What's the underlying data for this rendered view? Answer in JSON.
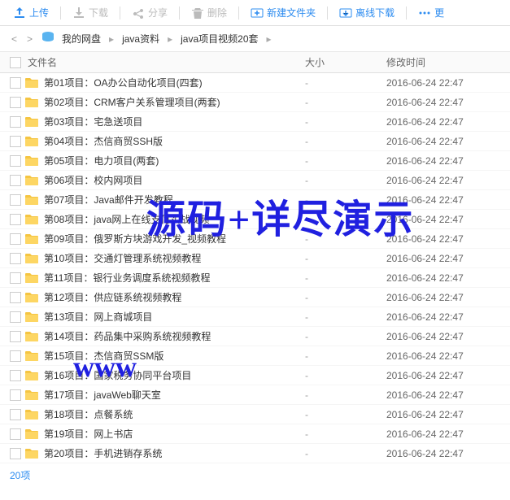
{
  "toolbar": {
    "upload": "上传",
    "download": "下载",
    "share": "分享",
    "delete": "删除",
    "new_folder": "新建文件夹",
    "offline_download": "离线下载",
    "more": "更"
  },
  "breadcrumb": {
    "root": "我的网盘",
    "p1": "java资料",
    "p2": "java项目视频20套"
  },
  "headers": {
    "name": "文件名",
    "size": "大小",
    "mtime": "修改时间"
  },
  "files": [
    {
      "name": "第01项目：OA办公自动化项目(四套)",
      "size": "-",
      "mtime": "2016-06-24 22:47"
    },
    {
      "name": "第02项目：CRM客户关系管理项目(两套)",
      "size": "-",
      "mtime": "2016-06-24 22:47"
    },
    {
      "name": "第03项目：宅急送项目",
      "size": "-",
      "mtime": "2016-06-24 22:47"
    },
    {
      "name": "第04项目：杰信商贸SSH版",
      "size": "-",
      "mtime": "2016-06-24 22:47"
    },
    {
      "name": "第05项目：电力项目(两套)",
      "size": "-",
      "mtime": "2016-06-24 22:47"
    },
    {
      "name": "第06项目：校内网项目",
      "size": "-",
      "mtime": "2016-06-24 22:47"
    },
    {
      "name": "第07项目：Java邮件开发教程",
      "size": "-",
      "mtime": "2016-06-24 22:47"
    },
    {
      "name": "第08项目：java网上在线支付实战视频",
      "size": "-",
      "mtime": "2016-06-24 22:47"
    },
    {
      "name": "第09项目：俄罗斯方块游戏开发_视频教程",
      "size": "-",
      "mtime": "2016-06-24 22:47"
    },
    {
      "name": "第10项目：交通灯管理系统视频教程",
      "size": "-",
      "mtime": "2016-06-24 22:47"
    },
    {
      "name": "第11项目：银行业务调度系统视频教程",
      "size": "-",
      "mtime": "2016-06-24 22:47"
    },
    {
      "name": "第12项目：供应链系统视频教程",
      "size": "-",
      "mtime": "2016-06-24 22:47"
    },
    {
      "name": "第13项目：网上商城项目",
      "size": "-",
      "mtime": "2016-06-24 22:47"
    },
    {
      "name": "第14项目：药品集中采购系统视频教程",
      "size": "-",
      "mtime": "2016-06-24 22:47"
    },
    {
      "name": "第15项目：杰信商贸SSM版",
      "size": "-",
      "mtime": "2016-06-24 22:47"
    },
    {
      "name": "第16项目：国家税务协同平台项目",
      "size": "-",
      "mtime": "2016-06-24 22:47"
    },
    {
      "name": "第17项目：javaWeb聊天室",
      "size": "-",
      "mtime": "2016-06-24 22:47"
    },
    {
      "name": "第18项目：点餐系统",
      "size": "-",
      "mtime": "2016-06-24 22:47"
    },
    {
      "name": "第19项目：网上书店",
      "size": "-",
      "mtime": "2016-06-24 22:47"
    },
    {
      "name": "第20项目：手机进销存系统",
      "size": "-",
      "mtime": "2016-06-24 22:47"
    }
  ],
  "footer": {
    "count": "20项"
  },
  "watermark": {
    "w1": "源码+详尽演示",
    "w2": "www"
  }
}
